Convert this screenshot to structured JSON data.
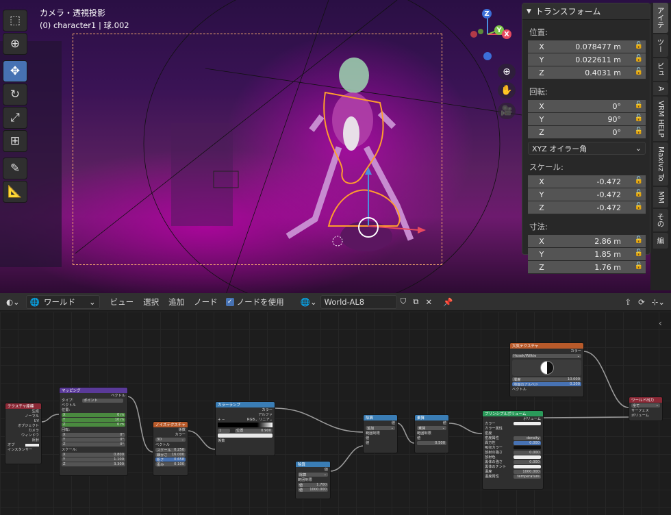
{
  "viewport": {
    "title": "カメラ・透視投影",
    "subtitle": "(0) character1 | 球.002",
    "tools": [
      "select-box",
      "cursor",
      "move",
      "rotate",
      "scale",
      "transform",
      "annotate",
      "measure"
    ],
    "gizmo": {
      "z": "Z",
      "y": "Y",
      "x": "X"
    },
    "nav": [
      "zoom",
      "pan",
      "camera"
    ]
  },
  "npanel": {
    "header": "トランスフォーム",
    "location_label": "位置:",
    "location": [
      {
        "axis": "X",
        "value": "0.078477 m"
      },
      {
        "axis": "Y",
        "value": "0.022611 m"
      },
      {
        "axis": "Z",
        "value": "0.4031 m"
      }
    ],
    "rotation_label": "回転:",
    "rotation": [
      {
        "axis": "X",
        "value": "0°"
      },
      {
        "axis": "Y",
        "value": "90°"
      },
      {
        "axis": "Z",
        "value": "0°"
      }
    ],
    "rotation_mode": "XYZ オイラー角",
    "scale_label": "スケール:",
    "scale": [
      {
        "axis": "X",
        "value": "-0.472"
      },
      {
        "axis": "Y",
        "value": "-0.472"
      },
      {
        "axis": "Z",
        "value": "-0.472"
      }
    ],
    "dims_label": "寸法:",
    "dims": [
      {
        "axis": "X",
        "value": "2.86 m"
      },
      {
        "axis": "Y",
        "value": "1.85 m"
      },
      {
        "axis": "Z",
        "value": "1.76 m"
      }
    ]
  },
  "sidetabs": [
    "アイテ",
    "ツー",
    "ビュ",
    "A",
    "VRM HELP",
    "Maxivz To",
    "MM",
    "その",
    "編"
  ],
  "header": {
    "world_type": "ワールド",
    "menus": [
      "ビュー",
      "選択",
      "追加",
      "ノード"
    ],
    "use_nodes": "ノードを使用",
    "world_name": "World-AL8"
  },
  "nodes": {
    "texcoord": {
      "title": "テクスチャ座標",
      "outs": [
        "生成",
        "ノーマル",
        "UV",
        "オブジェクト",
        "カメラ",
        "ウィンドウ",
        "反射"
      ],
      "object": "オブ",
      "instancer": "インスタンサー"
    },
    "mapping": {
      "title": "マッピング",
      "out": "ベクトル",
      "type_lbl": "タイプ:",
      "type": "ポイント",
      "vec": "ベクトル",
      "loc": "位置:",
      "loc_vals": [
        "0 m",
        "10 m",
        "0 m"
      ],
      "rot": "回転:",
      "rot_vals": [
        "0°",
        "0°",
        "0°"
      ],
      "scale": "スケール:",
      "scale_vals": [
        "0.800",
        "1.100",
        "3.300"
      ],
      "axes": [
        "X",
        "Y",
        "Z"
      ]
    },
    "noise": {
      "title": "ノイズテクスチャ",
      "outs": [
        "係数",
        "カラー"
      ],
      "dim": "3D",
      "vec": "ベクトル",
      "rows": [
        {
          "k": "スケール",
          "v": "0.250"
        },
        {
          "k": "細かさ",
          "v": "16.000"
        },
        {
          "k": "粗さ",
          "v": "0.658"
        },
        {
          "k": "歪み",
          "v": "0.100"
        }
      ]
    },
    "ramp": {
      "title": "カラーランプ",
      "outs": [
        "カラー",
        "アルファ"
      ],
      "mode": "RGB",
      "interp": "リニア",
      "idx": "1",
      "pos_lbl": "位置",
      "pos": "0.900",
      "in": "係数"
    },
    "math1": {
      "title": "除算",
      "out": "値",
      "op": "追加",
      "clamp": "範囲制限",
      "ins": [
        "値",
        "値"
      ]
    },
    "math2": {
      "title": "乗算",
      "out": "値",
      "op": "乗算",
      "clamp": "範囲制限",
      "in": "値",
      "val": "0.500"
    },
    "math3": {
      "title": "除算",
      "out": "値",
      "op": "除算",
      "clamp": "範囲制限",
      "rows": [
        {
          "k": "値",
          "v": "1.700"
        },
        {
          "k": "値",
          "v": "1000.000"
        }
      ]
    },
    "volume": {
      "title": "プリンシプルボリューム",
      "out": "ボリューム",
      "rows": [
        "カラー",
        "カラー属性",
        "密度",
        "密度属性",
        "異方性",
        "吸収カラー",
        "放射の強さ",
        "放射色",
        "黒体の強さ",
        "黒体のチント",
        "温度",
        "温度属性"
      ],
      "density_attr": "density",
      "aniso": "0.000",
      "emit": "0.000",
      "blackbody": "0.000",
      "temp": "1000.000",
      "temp_attr": "temperature"
    },
    "sky": {
      "title": "大気テクスチャ",
      "out": "カラー",
      "type": "Hosek/Wilkie",
      "turb": "濁度",
      "turb_v": "10.000",
      "albedo": "地面のアルベド",
      "albedo_v": "0.200",
      "vec": "ベクトル"
    },
    "output": {
      "title": "ワールド出力",
      "target": "全て",
      "ins": [
        "サーフェス",
        "ボリューム"
      ]
    }
  }
}
